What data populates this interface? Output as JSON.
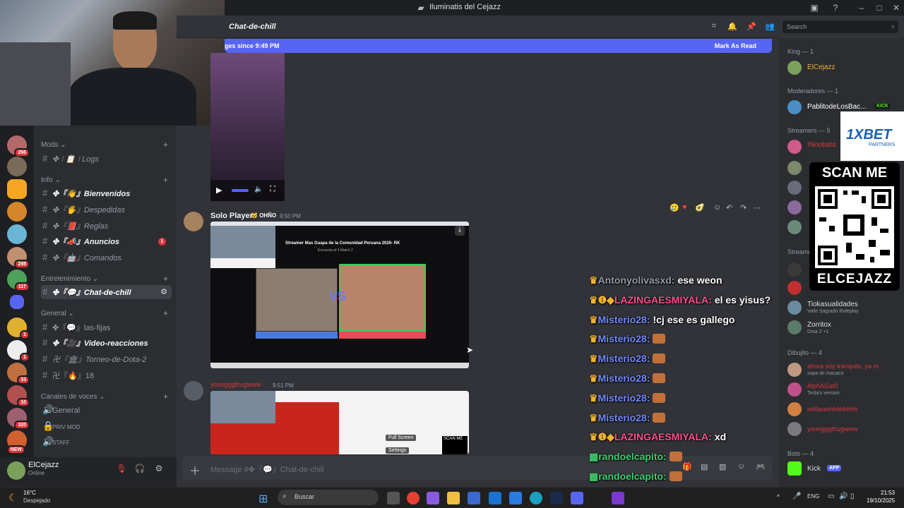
{
  "window": {
    "title": "Iluminatis del Cejazz"
  },
  "webcam": {
    "label": "streamer-webcam"
  },
  "channel_header": {
    "name": "Chat-de-chill"
  },
  "search": {
    "placeholder": "Search"
  },
  "new_messages_bar": {
    "text": "ges since 9:49 PM",
    "action": "Mark As Read"
  },
  "sidebar": {
    "categories": [
      {
        "label": "Mods ⌄"
      },
      {
        "label": "Info ⌄"
      },
      {
        "label": "Entretenimiento ⌄"
      },
      {
        "label": "General ⌄"
      },
      {
        "label": "Canales de voces ⌄"
      }
    ],
    "channels": [
      {
        "label": "✤ ⁝ 📋 ⁝ Logs"
      },
      {
        "label": "✤『👋』Bienvenidos"
      },
      {
        "label": "✤『🖐』Despedidas"
      },
      {
        "label": "✤『📕』Reglas"
      },
      {
        "label": "✤『📣』Anuncios",
        "badge": "1"
      },
      {
        "label": "✤『🤖』Comandos"
      },
      {
        "label": "✤『💬』Chat-de-chill"
      },
      {
        "label": "✤『💬』las-fijas"
      },
      {
        "label": "✤『🎥』Video-reacciones"
      },
      {
        "label": "卍『🏛』Torneo-de-Dota-2"
      },
      {
        "label": "卍『🔥』18"
      },
      {
        "label": "General"
      },
      {
        "label": "PRIV MOD"
      },
      {
        "label": "STAFF"
      }
    ]
  },
  "servers": {
    "badges": [
      "266",
      "298",
      "117",
      "1",
      "1",
      "33",
      "10",
      "320",
      "NEW"
    ]
  },
  "user_panel": {
    "name": "ElCejazz",
    "status": "Online"
  },
  "messages": [
    {
      "author": "Solo Player",
      "tag": "OHÑO",
      "time": "9:50 PM",
      "embed_title": "Streamer Mas Guapa de la Comunidad Peruana 2026- RK",
      "embed_sub": "Encuesta of 4 Match 2",
      "vs": "VS"
    },
    {
      "author": "yoongggthugwww",
      "time": "9:51 PM",
      "embed_buttons": [
        "Full Screen",
        "Settings"
      ],
      "scan": "SCAN ME"
    }
  ],
  "composer": {
    "placeholder": "Message #✤『💬』Chat-de-chill"
  },
  "overlay_chat": [
    {
      "name": "Antonyolivasxd:",
      "text": "ese weon",
      "crown": true,
      "style": "grey"
    },
    {
      "name": "LAZINGAESMIYALA:",
      "text": "el es yisus?",
      "crown": true,
      "badge": "1",
      "style": "pink"
    },
    {
      "name": "Misterio28:",
      "text": "!cj ese es gallego",
      "crown": true,
      "style": "blue"
    },
    {
      "name": "Misterio28:",
      "text": "",
      "crown": true,
      "emoji": true,
      "style": "blue"
    },
    {
      "name": "Misterio28:",
      "text": "",
      "crown": true,
      "emoji": true,
      "style": "blue"
    },
    {
      "name": "Misterio28:",
      "text": "",
      "crown": true,
      "emoji": true,
      "style": "blue"
    },
    {
      "name": "Misterio28:",
      "text": "",
      "crown": true,
      "emoji": true,
      "style": "blue"
    },
    {
      "name": "Misterio28:",
      "text": "",
      "crown": true,
      "emoji": true,
      "style": "blue"
    },
    {
      "name": "LAZINGAESMIYALA:",
      "text": "xd",
      "crown": true,
      "badge": "1",
      "style": "pink"
    },
    {
      "name": "randoelcapito:",
      "text": "",
      "emoji": true,
      "style": "green"
    },
    {
      "name": "randoelcapito:",
      "text": "",
      "emoji": true,
      "style": "green"
    },
    {
      "name": "randoelcapito:",
      "text": "",
      "emoji": true,
      "style": "green"
    }
  ],
  "members": {
    "sections": [
      {
        "label": "King — 1"
      },
      {
        "label": "Moderadores — 1"
      },
      {
        "label": "Streamers — 5"
      },
      {
        "label": "Streame"
      },
      {
        "label": "Dibujito — 4"
      },
      {
        "label": "Bots — 4"
      }
    ],
    "list": [
      {
        "name": "ElCejazz",
        "color": "#f0b232"
      },
      {
        "name": "PablitodeLosBac...",
        "color": "#ffffff",
        "badge": "KICK"
      },
      {
        "name": "!Noobata",
        "color": "#da373c"
      },
      {
        "name": "Tiokasualidades",
        "color": "#dbdee1",
        "sub": "Valle Sagrado Roleplay"
      },
      {
        "name": "Zorritox",
        "color": "#dbdee1",
        "sub": "Dota 2 +1"
      },
      {
        "name": "ahora soy tranquilo, ya m...",
        "color": "#da373c",
        "sub": "sopa de macaco"
      },
      {
        "name": "AlphAGat0",
        "color": "#da373c",
        "sub": "Tesla's version"
      },
      {
        "name": "isMarashhhhhhhh",
        "color": "#da373c"
      },
      {
        "name": "yoongggthugwww",
        "color": "#da373c"
      },
      {
        "name": "Kick",
        "color": "#dbdee1",
        "badge": "APP"
      }
    ]
  },
  "sponsor": {
    "brand": "1XBET",
    "sub": "PARTNERS",
    "scan": "SCAN ME",
    "handle": "ELCEJAZZ"
  },
  "taskbar": {
    "weather_temp": "16°C",
    "weather_desc": "Despejado",
    "search": "Buscar",
    "lang": "ENG",
    "time": "21:53",
    "date": "19/10/2025"
  },
  "colors": {
    "blurple": "#5865f2",
    "bg": "#313338",
    "sidebar": "#2b2d31",
    "red": "#da373c"
  }
}
